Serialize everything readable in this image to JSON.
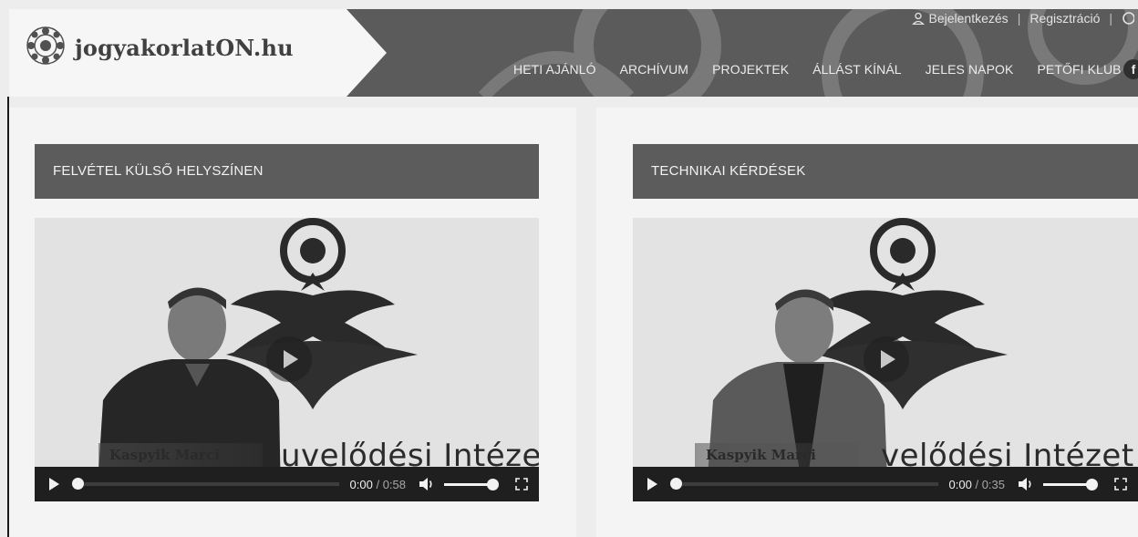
{
  "site": {
    "logo_text": "jogyakorlatON.hu"
  },
  "topbar": {
    "login_label": "Bejelentkezés",
    "register_label": "Regisztráció"
  },
  "nav": {
    "items": [
      {
        "label": "HETI AJÁNLÓ"
      },
      {
        "label": "ARCHÍVUM"
      },
      {
        "label": "PROJEKTEK"
      },
      {
        "label": "ÁLLÁST KÍNÁL"
      },
      {
        "label": "JELES NAPOK"
      },
      {
        "label": "PETŐFI KLUB"
      }
    ],
    "social_icon": "facebook-icon"
  },
  "panels": [
    {
      "title": "FELVÉTEL KÜLSŐ HELYSZÍNEN",
      "video": {
        "presenter_name": "Kaspyik Marci",
        "overlay_text": "uvelődési Intézet",
        "current_time": "0:00",
        "duration": "0:58",
        "progress_fraction": 0,
        "volume_fraction": 1
      }
    },
    {
      "title": "TECHNIKAI KÉRDÉSEK",
      "video": {
        "presenter_name": "Kaspyik Marci",
        "overlay_text": "velődési Intézet",
        "current_time": "0:00",
        "duration": "0:35",
        "progress_fraction": 0,
        "volume_fraction": 1
      }
    }
  ],
  "colors": {
    "header_bg": "#5b5b5b",
    "panel_title_bg": "#5c5c5c",
    "controls_bg": "#1f1f1f"
  }
}
